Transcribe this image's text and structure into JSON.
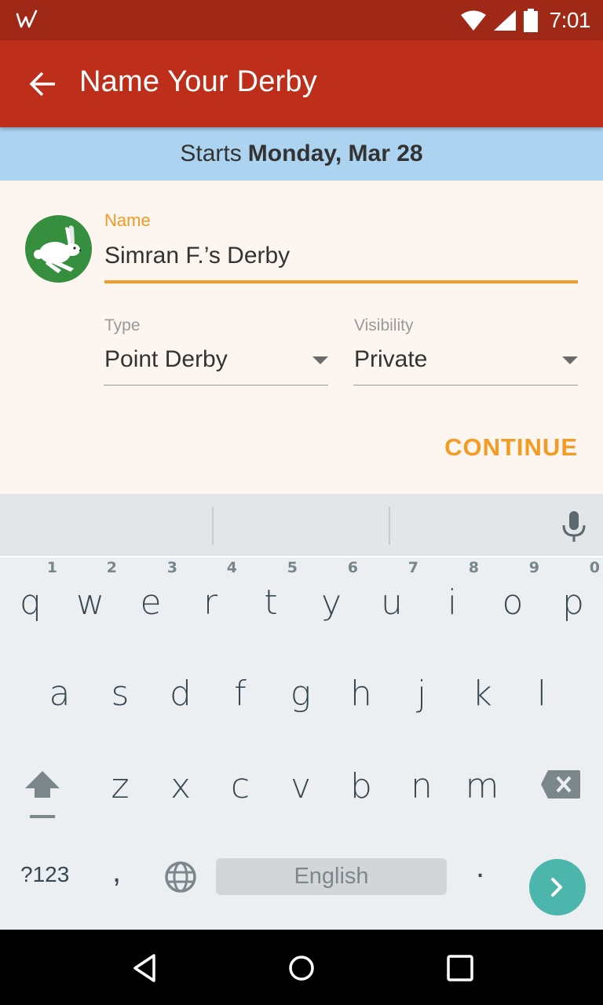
{
  "status_bar": {
    "app_icon": "w-logo-icon",
    "icons": [
      "wifi-icon",
      "signal-icon",
      "battery-icon"
    ],
    "time": "7:01"
  },
  "app_bar": {
    "back_icon": "arrow-back-icon",
    "title": "Name Your Derby"
  },
  "banner": {
    "prefix": "Starts",
    "date": "Monday, Mar 28"
  },
  "form": {
    "avatar": "rabbit-avatar",
    "name": {
      "label": "Name",
      "value": "Simran F.’s Derby"
    },
    "type": {
      "label": "Type",
      "value": "Point Derby"
    },
    "visibility": {
      "label": "Visibility",
      "value": "Private"
    },
    "continue_label": "CONTINUE"
  },
  "colors": {
    "status_bar": "#a02816",
    "app_bar": "#bd2f1a",
    "banner": "#acd4f0",
    "form_bg": "#fdf5ef",
    "accent": "#f19a25",
    "enter_key": "#4db6ac"
  },
  "keyboard": {
    "row1": [
      {
        "key": "q",
        "hint": "1"
      },
      {
        "key": "w",
        "hint": "2"
      },
      {
        "key": "e",
        "hint": "3"
      },
      {
        "key": "r",
        "hint": "4"
      },
      {
        "key": "t",
        "hint": "5"
      },
      {
        "key": "y",
        "hint": "6"
      },
      {
        "key": "u",
        "hint": "7"
      },
      {
        "key": "i",
        "hint": "8"
      },
      {
        "key": "o",
        "hint": "9"
      },
      {
        "key": "p",
        "hint": "0"
      }
    ],
    "row2": [
      "a",
      "s",
      "d",
      "f",
      "g",
      "h",
      "j",
      "k",
      "l"
    ],
    "row3": [
      "z",
      "x",
      "c",
      "v",
      "b",
      "n",
      "m"
    ],
    "symbols_label": "?123",
    "comma": ",",
    "space_label": "English",
    "period": ".",
    "suggestions": [
      "",
      "",
      ""
    ]
  }
}
